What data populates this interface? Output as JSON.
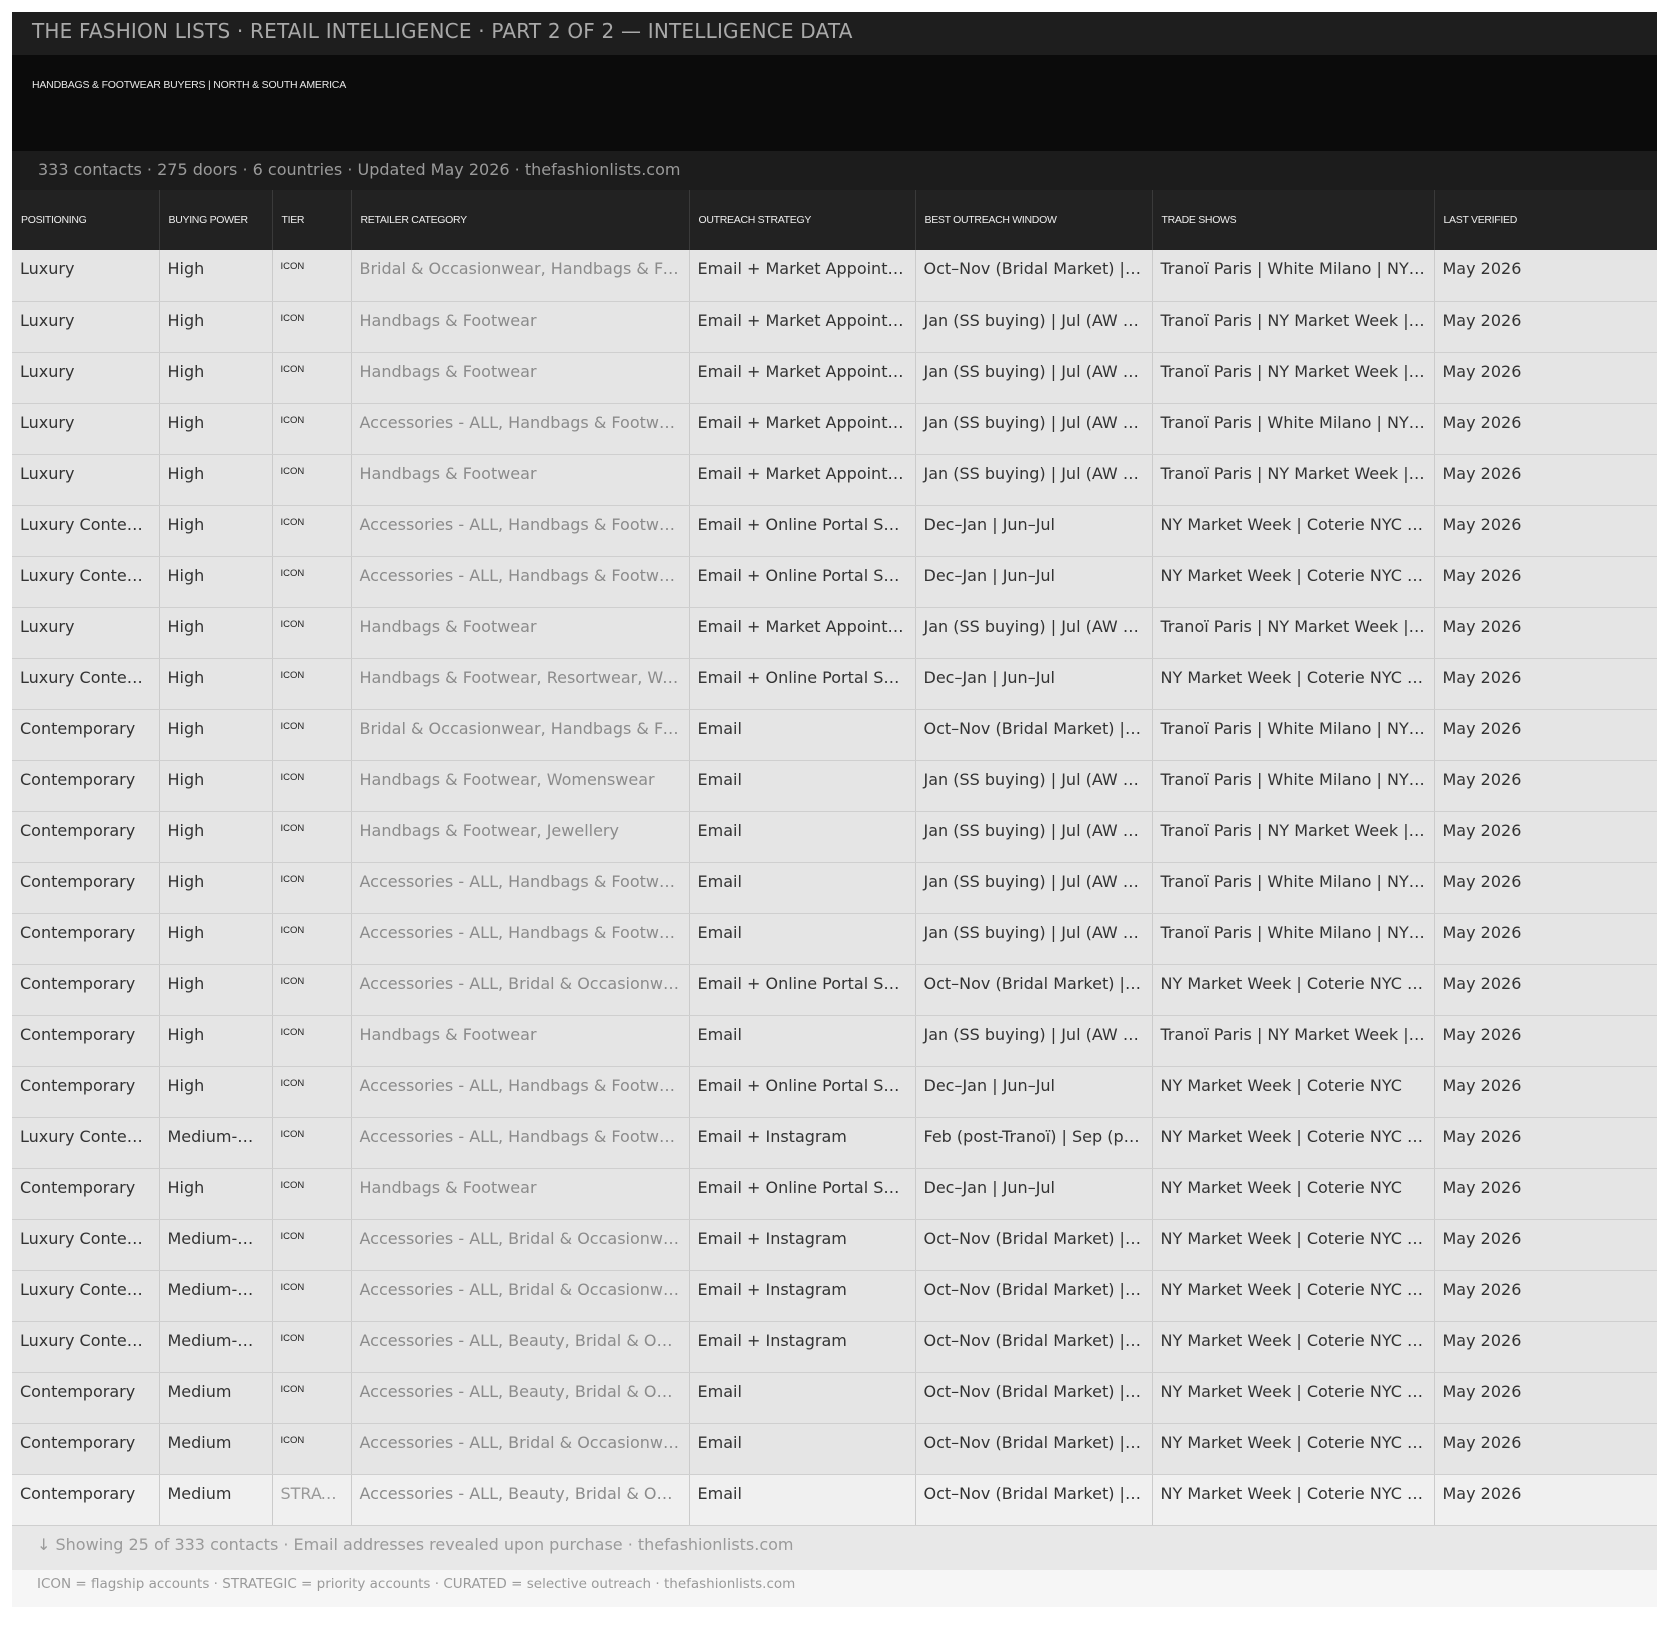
{
  "header": {
    "title": "THE FASHION LISTS  ·  RETAIL INTELLIGENCE  ·  PART 2 OF 2 — INTELLIGENCE DATA",
    "subtitle": "HANDBAGS & FOOTWEAR BUYERS | NORTH & SOUTH AMERICA",
    "stats": "333 contacts  ·  275 doors  ·  6 countries  ·  Updated May 2026  ·  thefashionlists.com"
  },
  "table": {
    "columns": [
      "POSITIONING",
      "BUYING POWER",
      "TIER",
      "RETAILER CATEGORY",
      "OUTREACH STRATEGY",
      "BEST OUTREACH WINDOW",
      "TRADE SHOWS",
      "LAST VERIFIED"
    ],
    "rows": [
      [
        "Luxury",
        "High",
        "ICON",
        "Bridal & Occasionwear, Handbags & Footwear",
        "Email + Market Appointment",
        "Oct–Nov (Bridal Market) | Apr",
        "Tranoï Paris | White Milano | NY Market Week",
        "May 2026"
      ],
      [
        "Luxury",
        "High",
        "ICON",
        "Handbags & Footwear",
        "Email + Market Appointment",
        "Jan (SS buying) | Jul (AW buying)",
        "Tranoï Paris | NY Market Week | Coterie NYC",
        "May 2026"
      ],
      [
        "Luxury",
        "High",
        "ICON",
        "Handbags & Footwear",
        "Email + Market Appointment",
        "Jan (SS buying) | Jul (AW buying)",
        "Tranoï Paris | NY Market Week | Coterie NYC",
        "May 2026"
      ],
      [
        "Luxury",
        "High",
        "ICON",
        "Accessories - ALL, Handbags & Footwear, Jewellery",
        "Email + Market Appointment",
        "Jan (SS buying) | Jul (AW buying)",
        "Tranoï Paris | White Milano | NY Market Week",
        "May 2026"
      ],
      [
        "Luxury",
        "High",
        "ICON",
        "Handbags & Footwear",
        "Email + Market Appointment",
        "Jan (SS buying) | Jul (AW buying)",
        "Tranoï Paris | NY Market Week | Coterie NYC",
        "May 2026"
      ],
      [
        "Luxury Contemporary",
        "High",
        "ICON",
        "Accessories - ALL, Handbags & Footwear, Jewellery",
        "Email + Online Portal Submission",
        "Dec–Jan | Jun–Jul",
        "NY Market Week | Coterie NYC | Capsule",
        "May 2026"
      ],
      [
        "Luxury Contemporary",
        "High",
        "ICON",
        "Accessories - ALL, Handbags & Footwear, Jewellery",
        "Email + Online Portal Submission",
        "Dec–Jan | Jun–Jul",
        "NY Market Week | Coterie NYC | Capsule",
        "May 2026"
      ],
      [
        "Luxury",
        "High",
        "ICON",
        "Handbags & Footwear",
        "Email + Market Appointment",
        "Jan (SS buying) | Jul (AW buying)",
        "Tranoï Paris | NY Market Week | Coterie NYC",
        "May 2026"
      ],
      [
        "Luxury Contemporary",
        "High",
        "ICON",
        "Handbags & Footwear, Resortwear, Womenswear",
        "Email + Online Portal Submission",
        "Dec–Jan | Jun–Jul",
        "NY Market Week | Coterie NYC | Capsule",
        "May 2026"
      ],
      [
        "Contemporary",
        "High",
        "ICON",
        "Bridal & Occasionwear, Handbags & Footwear",
        "Email",
        "Oct–Nov (Bridal Market) | Apr",
        "Tranoï Paris | White Milano | NY Market Week",
        "May 2026"
      ],
      [
        "Contemporary",
        "High",
        "ICON",
        "Handbags & Footwear, Womenswear",
        "Email",
        "Jan (SS buying) | Jul (AW buying)",
        "Tranoï Paris | White Milano | NY Market Week",
        "May 2026"
      ],
      [
        "Contemporary",
        "High",
        "ICON",
        "Handbags & Footwear, Jewellery",
        "Email",
        "Jan (SS buying) | Jul (AW buying)",
        "Tranoï Paris | NY Market Week | Coterie NYC",
        "May 2026"
      ],
      [
        "Contemporary",
        "High",
        "ICON",
        "Accessories - ALL, Handbags & Footwear",
        "Email",
        "Jan (SS buying) | Jul (AW buying)",
        "Tranoï Paris | White Milano | NY Market Week",
        "May 2026"
      ],
      [
        "Contemporary",
        "High",
        "ICON",
        "Accessories - ALL, Handbags & Footwear",
        "Email",
        "Jan (SS buying) | Jul (AW buying)",
        "Tranoï Paris | White Milano | NY Market Week",
        "May 2026"
      ],
      [
        "Contemporary",
        "High",
        "ICON",
        "Accessories - ALL, Bridal & Occasionwear, Handbags & Footwear",
        "Email + Online Portal Submission",
        "Oct–Nov (Bridal Market) | Apr",
        "NY Market Week | Coterie NYC | ITS",
        "May 2026"
      ],
      [
        "Contemporary",
        "High",
        "ICON",
        "Handbags & Footwear",
        "Email",
        "Jan (SS buying) | Jul (AW buying)",
        "Tranoï Paris | NY Market Week | Coterie NYC",
        "May 2026"
      ],
      [
        "Contemporary",
        "High",
        "ICON",
        "Accessories - ALL, Handbags & Footwear",
        "Email + Online Portal Submission",
        "Dec–Jan | Jun–Jul",
        "NY Market Week | Coterie NYC",
        "May 2026"
      ],
      [
        "Luxury Contemporary",
        "Medium-High",
        "ICON",
        "Accessories - ALL, Handbags & Footwear, Jewellery",
        "Email + Instagram",
        "Feb (post-Tranoï) | Sep (post-Tranoï)",
        "NY Market Week | Coterie NYC | Capsule",
        "May 2026"
      ],
      [
        "Contemporary",
        "High",
        "ICON",
        "Handbags & Footwear",
        "Email + Online Portal Submission",
        "Dec–Jan | Jun–Jul",
        "NY Market Week | Coterie NYC",
        "May 2026"
      ],
      [
        "Luxury Contemporary",
        "Medium-High",
        "ICON",
        "Accessories - ALL, Bridal & Occasionwear, Handbags & Footwear",
        "Email + Instagram",
        "Oct–Nov (Bridal Market) | Apr",
        "NY Market Week | Coterie NYC | ITS",
        "May 2026"
      ],
      [
        "Luxury Contemporary",
        "Medium-High",
        "ICON",
        "Accessories - ALL, Bridal & Occasionwear, Handbags & Footwear",
        "Email + Instagram",
        "Oct–Nov (Bridal Market) | Apr",
        "NY Market Week | Coterie NYC | ITS",
        "May 2026"
      ],
      [
        "Luxury Contemporary",
        "Medium-High",
        "ICON",
        "Accessories - ALL, Beauty, Bridal & Occasionwear",
        "Email + Instagram",
        "Oct–Nov (Bridal Market) | Apr",
        "NY Market Week | Coterie NYC | ITS",
        "May 2026"
      ],
      [
        "Contemporary",
        "Medium",
        "ICON",
        "Accessories - ALL, Beauty, Bridal & Occasionwear",
        "Email",
        "Oct–Nov (Bridal Market) | Apr",
        "NY Market Week | Coterie NYC | ITS",
        "May 2026"
      ],
      [
        "Contemporary",
        "Medium",
        "ICON",
        "Accessories - ALL, Bridal & Occasionwear, Handbags & Footwear",
        "Email",
        "Oct–Nov (Bridal Market) | Apr",
        "NY Market Week | Coterie NYC | ITS",
        "May 2026"
      ],
      [
        "Contemporary",
        "Medium",
        "STRATEGIC",
        "Accessories - ALL, Beauty, Bridal & Occasionwear",
        "Email",
        "Oct–Nov (Bridal Market) | Apr",
        "NY Market Week | Coterie NYC | ITS",
        "May 2026"
      ]
    ]
  },
  "footer": {
    "showing": "↓  Showing 25 of 333 contacts  ·  Email addresses revealed upon purchase  ·  thefashionlists.com",
    "legend": "ICON = flagship accounts  ·  STRATEGIC = priority accounts  ·  CURATED = selective outreach  ·  thefashionlists.com"
  }
}
